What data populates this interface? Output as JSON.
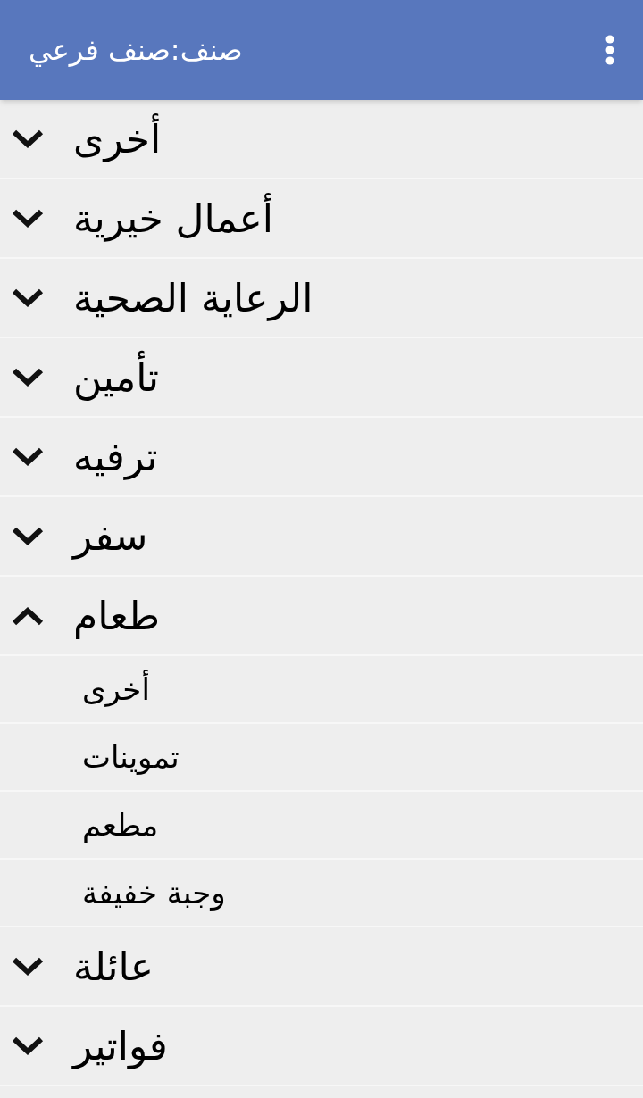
{
  "app_bar": {
    "title": "صنف:صنف فرعي"
  },
  "categories": [
    {
      "label": "أخرى",
      "expanded": false
    },
    {
      "label": "أعمال خيرية",
      "expanded": false
    },
    {
      "label": "الرعاية الصحية",
      "expanded": false
    },
    {
      "label": "تأمين",
      "expanded": false
    },
    {
      "label": "ترفيه",
      "expanded": false
    },
    {
      "label": "سفر",
      "expanded": false
    },
    {
      "label": "طعام",
      "expanded": true,
      "children": [
        {
          "label": "أخرى"
        },
        {
          "label": "تموينات"
        },
        {
          "label": "مطعم"
        },
        {
          "label": "وجبة خفيفة"
        }
      ]
    },
    {
      "label": "عائلة",
      "expanded": false
    },
    {
      "label": "فواتير",
      "expanded": false
    }
  ]
}
